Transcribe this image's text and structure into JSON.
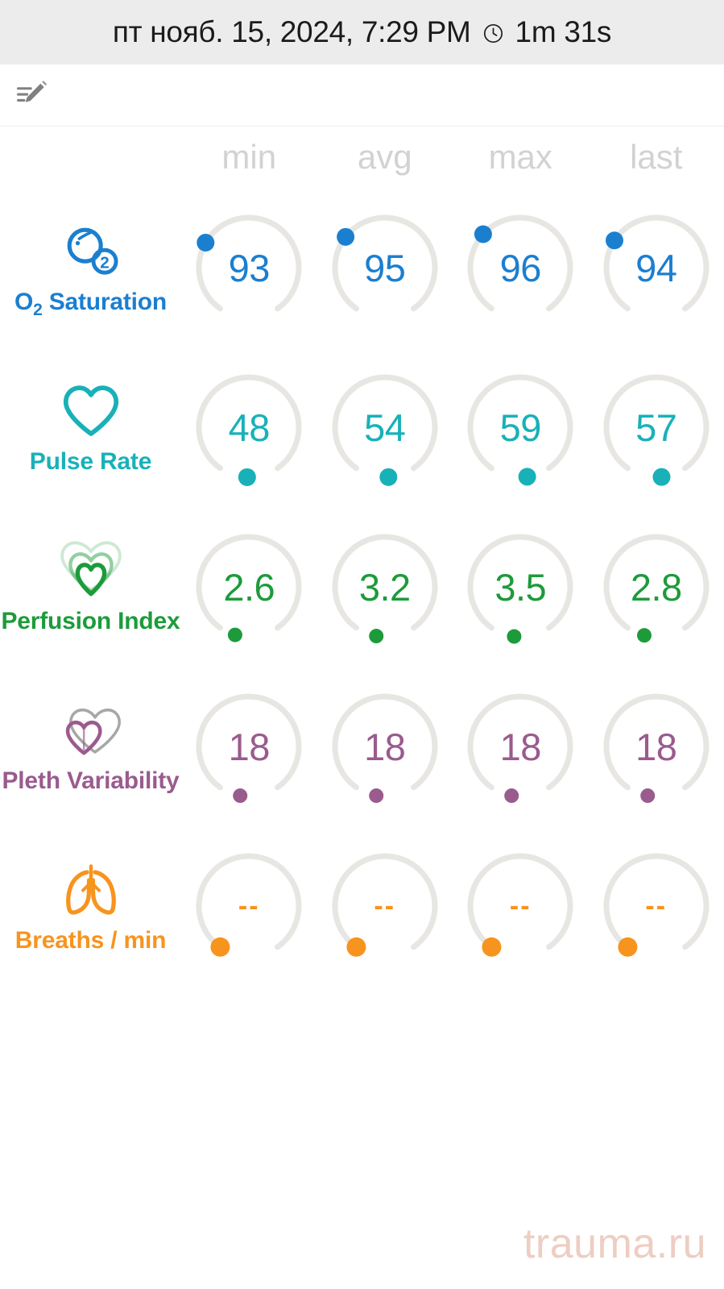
{
  "header": {
    "datetime": "пт нояб. 15, 2024, 7:29 PM",
    "clock_icon": "clock-icon",
    "duration": "1m 31s",
    "background": "#ececec"
  },
  "note": {
    "edit_icon": "note-edit-icon"
  },
  "columns": [
    {
      "label": "min"
    },
    {
      "label": "avg"
    },
    {
      "label": "max"
    },
    {
      "label": "last"
    }
  ],
  "metrics": [
    {
      "id": "o2-saturation",
      "label_main": "O",
      "label_sub": "2",
      "label_rest": " Saturation",
      "icon": "o2-molecule-icon",
      "color": "#1b7fd0",
      "values": {
        "min": "93",
        "avg": "95",
        "max": "96",
        "last": "94"
      },
      "dot_positions_deg": [
        300,
        308,
        312,
        303
      ],
      "dot_radius": 11
    },
    {
      "id": "pulse-rate",
      "label_main": "Pulse Rate",
      "icon": "heart-outline-icon",
      "color": "#19b1b8",
      "values": {
        "min": "48",
        "avg": "54",
        "max": "59",
        "last": "57"
      },
      "dot_positions_deg": [
        182,
        176,
        172,
        174
      ],
      "dot_radius": 11
    },
    {
      "id": "perfusion-index",
      "label_main": "Perfusion Index",
      "icon": "triple-heart-icon",
      "color": "#1d9b3b",
      "values": {
        "min": "2.6",
        "avg": "3.2",
        "max": "3.5",
        "last": "2.8"
      },
      "dot_positions_deg": [
        196,
        190,
        187,
        194
      ],
      "dot_radius": 9
    },
    {
      "id": "pleth-variability",
      "label_main": "Pleth Variability",
      "icon": "double-heart-icon",
      "color": "#9a5b8e",
      "values": {
        "min": "18",
        "avg": "18",
        "max": "18",
        "last": "18"
      },
      "dot_positions_deg": [
        190,
        190,
        190,
        190
      ],
      "dot_radius": 9
    },
    {
      "id": "breaths-per-min",
      "label_main": "Breaths / min",
      "icon": "lungs-icon",
      "color": "#f7941e",
      "values": {
        "min": "--",
        "avg": "--",
        "max": "--",
        "last": "--"
      },
      "dot_positions_deg": [
        215,
        215,
        215,
        215
      ],
      "dot_radius": 12
    }
  ],
  "gauge": {
    "track_color": "#e8e6e2",
    "start_deg": 215,
    "sweep_deg": 290
  },
  "watermark": {
    "text": "trauma.ru",
    "color": "#edcec2"
  }
}
